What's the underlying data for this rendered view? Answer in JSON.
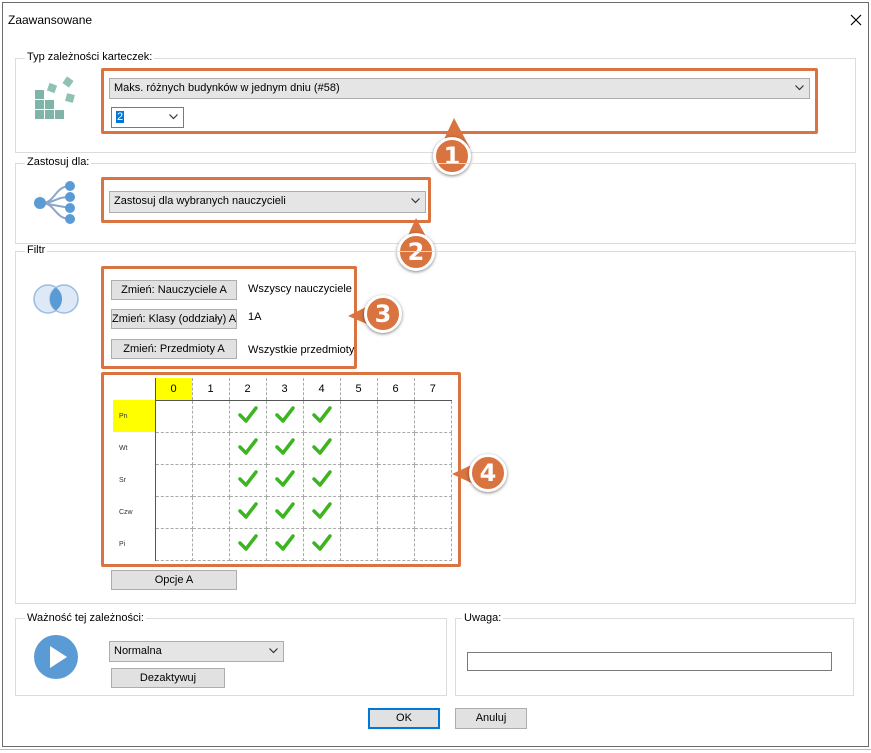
{
  "window": {
    "title": "Zaawansowane"
  },
  "dependency_type": {
    "label": "Typ zależności karteczek:",
    "selected": "Maks. różnych budynków w jednym dniu (#58)",
    "param_value": "2"
  },
  "apply_for": {
    "label": "Zastosuj dla:",
    "selected": "Zastosuj dla wybranych nauczycieli"
  },
  "filter": {
    "label": "Filtr",
    "rows": [
      {
        "button": "Zmień: Nauczyciele A",
        "value": "Wszyscy nauczyciele"
      },
      {
        "button": "Zmień: Klasy (oddziały) A",
        "value": "1A"
      },
      {
        "button": "Zmień: Przedmioty A",
        "value": "Wszystkie przedmioty"
      }
    ]
  },
  "grid": {
    "columns": [
      "0",
      "1",
      "2",
      "3",
      "4",
      "5",
      "6",
      "7"
    ],
    "rows": [
      {
        "day": "Pn",
        "checked": [
          false,
          false,
          true,
          true,
          true,
          false,
          false,
          false
        ]
      },
      {
        "day": "Wt",
        "checked": [
          false,
          false,
          true,
          true,
          true,
          false,
          false,
          false
        ]
      },
      {
        "day": "Sr",
        "checked": [
          false,
          false,
          true,
          true,
          true,
          false,
          false,
          false
        ]
      },
      {
        "day": "Czw",
        "checked": [
          false,
          false,
          true,
          true,
          true,
          false,
          false,
          false
        ]
      },
      {
        "day": "Pi",
        "checked": [
          false,
          false,
          true,
          true,
          true,
          false,
          false,
          false
        ]
      }
    ],
    "options_button": "Opcje A"
  },
  "importance": {
    "label": "Ważność tej zależności:",
    "selected": "Normalna",
    "deactivate_button": "Dezaktywuj"
  },
  "note": {
    "label": "Uwaga:",
    "value": ""
  },
  "footer": {
    "ok": "OK",
    "cancel": "Anuluj"
  },
  "callouts": [
    "1",
    "2",
    "3",
    "4"
  ],
  "colors": {
    "callout": "#d9733f",
    "highlight": "#ffff00",
    "check": "#3cb521",
    "icon_teal": "#7fb5a8",
    "icon_blue": "#5b9bd5"
  }
}
